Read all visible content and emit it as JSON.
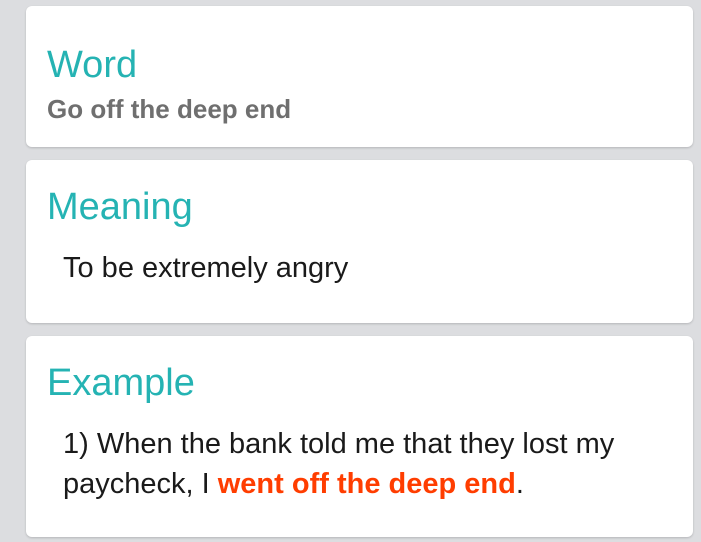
{
  "word_card": {
    "title": "Word",
    "text": "Go off the deep end"
  },
  "meaning_card": {
    "title": "Meaning",
    "text": "To be extremely angry"
  },
  "example_card": {
    "title": "Example",
    "sentence_prefix": "1) When the bank told me that they lost my paycheck, I ",
    "highlight": "went off the deep end",
    "sentence_suffix": "."
  },
  "colors": {
    "accent": "#25b3b3",
    "highlight": "#ff3d00",
    "background": "#dcdde0"
  }
}
